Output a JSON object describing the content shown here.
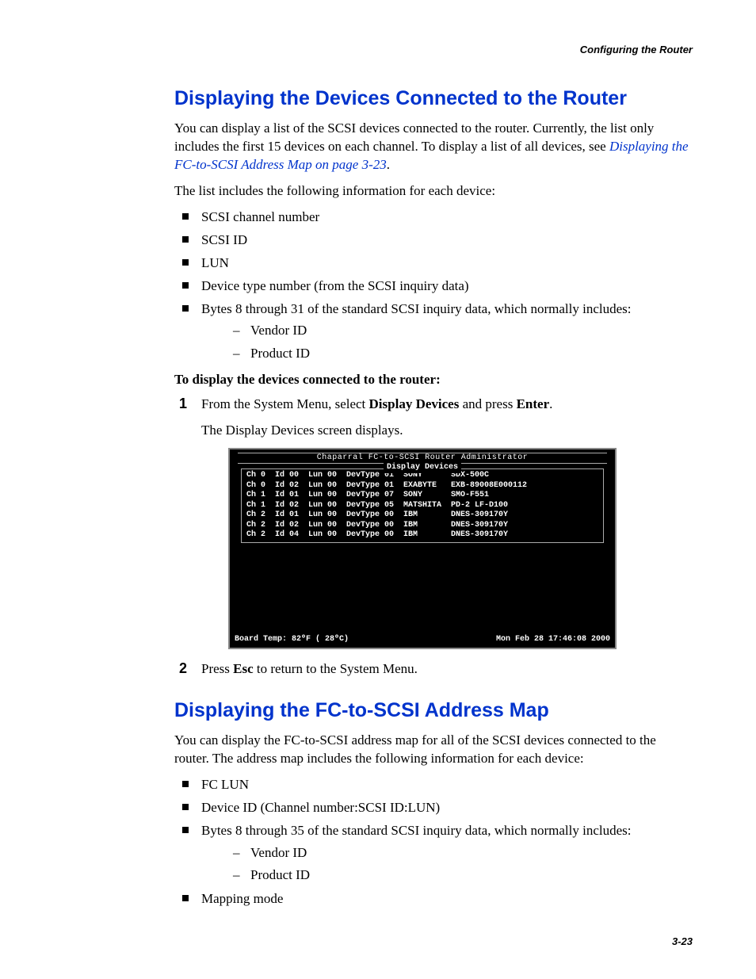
{
  "running_header": "Configuring the Router",
  "page_number": "3-23",
  "section1": {
    "title": "Displaying the Devices Connected to the Router",
    "intro_plain": "You can display a list of the SCSI devices connected to the router. Currently, the list only includes the first 15 devices on each channel. To display a list of all devices, see ",
    "intro_xref": "Displaying the FC-to-SCSI Address Map on page 3-23",
    "intro_tail": ".",
    "list_lead": "The list includes the following information for each device:",
    "bullets": {
      "b1": "SCSI channel number",
      "b2": "SCSI ID",
      "b3": "LUN",
      "b4": "Device type number (from the SCSI inquiry data)",
      "b5": "Bytes 8 through 31 of the standard SCSI inquiry data, which normally includes:",
      "b5a": "Vendor ID",
      "b5b": "Product ID"
    },
    "task_lead": "To display the devices connected to the router:",
    "step1_pre": "From the System Menu, select ",
    "step1_bold1": "Display Devices",
    "step1_mid": " and press ",
    "step1_bold2": "Enter",
    "step1_post": ".",
    "step1_body": "The Display Devices screen displays.",
    "step2_pre": "Press ",
    "step2_bold": "Esc",
    "step2_post": " to return to the System Menu."
  },
  "terminal": {
    "title": "Chaparral FC-to-SCSI Router Administrator",
    "box_label": "Display Devices",
    "rows": [
      "Ch 0  Id 00  Lun 00  DevType 01  SONY      SDX-500C",
      "Ch 0  Id 02  Lun 00  DevType 01  EXABYTE   EXB-89008E000112",
      "Ch 1  Id 01  Lun 00  DevType 07  SONY      SMO-F551",
      "Ch 1  Id 02  Lun 00  DevType 05  MATSHITA  PD-2 LF-D100",
      "Ch 2  Id 01  Lun 00  DevType 00  IBM       DNES-309170Y",
      "Ch 2  Id 02  Lun 00  DevType 00  IBM       DNES-309170Y",
      "Ch 2  Id 04  Lun 00  DevType 00  IBM       DNES-309170Y"
    ],
    "footer_left": "Board Temp:  82ºF ( 28ºC)",
    "footer_right": "Mon Feb 28 17:46:08 2000"
  },
  "section2": {
    "title": "Displaying the FC-to-SCSI Address Map",
    "intro": "You can display the FC-to-SCSI address map for all of the SCSI devices connected to the router. The address map includes the following information for each device:",
    "bullets": {
      "b1": "FC LUN",
      "b2": "Device ID (Channel number:SCSI ID:LUN)",
      "b3": "Bytes 8 through 35 of the standard SCSI inquiry data, which normally includes:",
      "b3a": "Vendor ID",
      "b3b": "Product ID",
      "b4": "Mapping mode"
    }
  }
}
